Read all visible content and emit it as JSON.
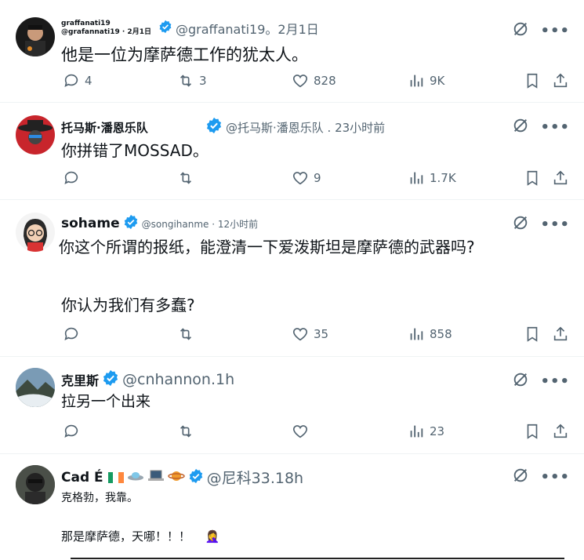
{
  "tweets": [
    {
      "name": "graffanati19 @grafannati19 · 2月1日",
      "handle_time": "@graffanati19。2月1日",
      "lines": [
        "他是一位为摩萨德工作的犹太人。"
      ],
      "replies": "4",
      "retweets": "3",
      "likes": "828",
      "views": "9K"
    },
    {
      "name": "托马斯·潘恩乐队",
      "handle_time": "@托马斯·潘恩乐队 . 23小时前",
      "lines": [
        "你拼错了MOSSAD。"
      ],
      "replies": "",
      "retweets": "",
      "likes": "9",
      "views": "1.7K"
    },
    {
      "name": "sohame",
      "handle_time": "@songihanme · 12小时前",
      "lines": [
        "你这个所谓的报纸，能澄清一下爱泼斯坦是摩萨德的武器吗?",
        "你认为我们有多蠢?"
      ],
      "replies": "",
      "retweets": "",
      "likes": "35",
      "views": "858"
    },
    {
      "name": "克里斯",
      "handle_time": "@cnhannon.1h",
      "lines": [
        "拉另一个出来"
      ],
      "replies": "",
      "retweets": "",
      "likes": "",
      "views": "23"
    },
    {
      "name": "Cad É",
      "handle_time": "@尼科33.18h",
      "lines": [
        "克格勃，我靠。",
        "那是摩萨德，天哪！！！"
      ],
      "emoji": "🤦‍♀️"
    }
  ],
  "colors": {
    "verified": "#1d9bf0",
    "secondary": "#536471",
    "text": "#0f1419"
  }
}
